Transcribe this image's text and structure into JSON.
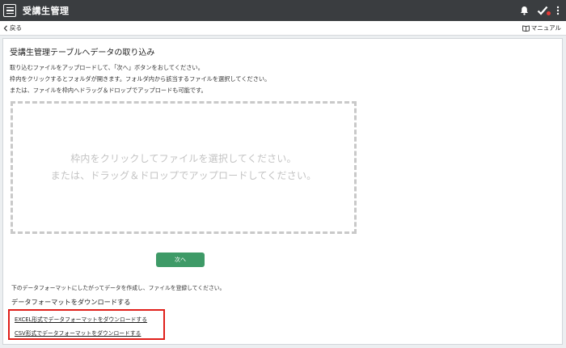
{
  "header": {
    "app_title": "受講生管理",
    "icons": {
      "menu": "hamburger-menu-icon",
      "bell": "bell-icon",
      "check": "checkmark-icon",
      "more": "more-vertical-icon"
    },
    "colors": {
      "bar": "#3a3d40",
      "notification_dot": "#e53935"
    }
  },
  "subbar": {
    "back_label": "戻る",
    "manual_label": "マニュアル"
  },
  "main": {
    "heading": "受講生管理テーブルへデータの取り込み",
    "instructions": [
      "取り込むファイルをアップロードして、「次へ」ボタンをおしてください。",
      "枠内をクリックするとフォルダが開きます。フォルダ内から該当するファイルを選択してください。",
      "または、ファイルを枠内へドラッグ＆ドロップでアップロードも可能です。"
    ],
    "dropzone": {
      "line1": "枠内をクリックしてファイルを選択してください。",
      "line2": "または、ドラッグ＆ドロップでアップロードしてください。"
    },
    "next_label": "次へ",
    "note": "下のデータフォーマットにしたがってデータを作成し、ファイルを登録してください。",
    "download_heading": "データフォーマットをダウンロードする",
    "downloads": {
      "excel": "EXCEL形式でデータフォーマットをダウンロードする",
      "csv": "CSV形式でデータフォーマットをダウンロードする"
    },
    "colors": {
      "next_button": "#3e9a67",
      "highlight_box": "#e0201b"
    }
  }
}
